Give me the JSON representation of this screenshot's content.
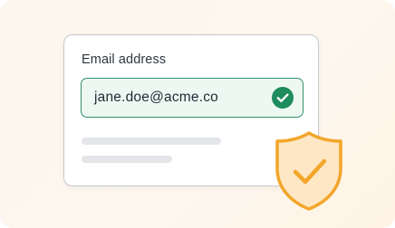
{
  "form": {
    "email_label": "Email address",
    "email_value": "jane.doe@acme.co"
  },
  "icons": {
    "valid": "check-circle-icon",
    "security": "shield-check-icon"
  },
  "colors": {
    "success": "#1e8c5c",
    "field_bg": "#eef8f3",
    "shield_stroke": "#f2a62a",
    "shield_fill": "#fde7c4",
    "placeholder_line": "#e4e5e8"
  }
}
